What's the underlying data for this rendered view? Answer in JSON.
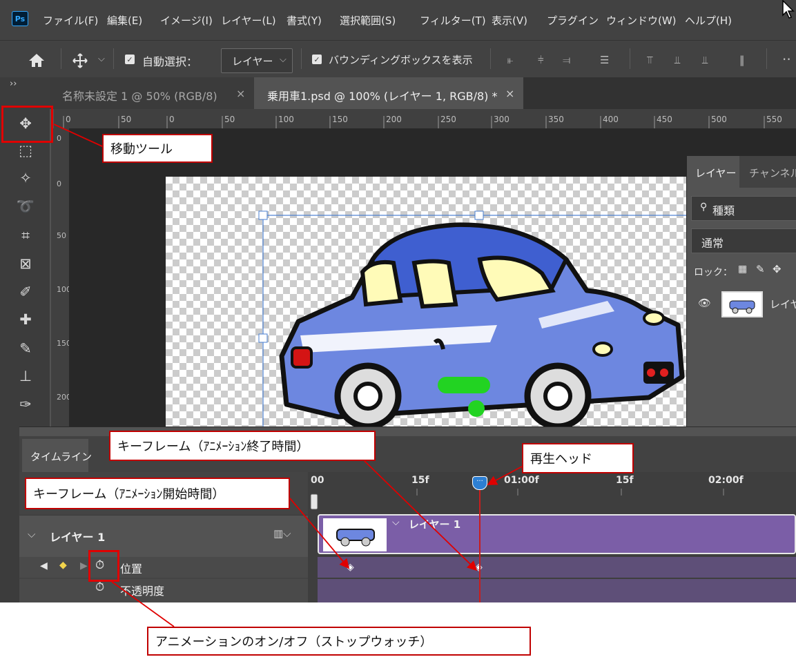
{
  "app": {
    "logo": "Ps"
  },
  "menu": [
    "ファイル(F)",
    "編集(E)",
    "イメージ(I)",
    "レイヤー(L)",
    "書式(Y)",
    "選択範囲(S)",
    "フィルター(T)",
    "表示(V)",
    "プラグイン",
    "ウィンドウ(W)",
    "ヘルプ(H)"
  ],
  "options": {
    "auto_select_label": "自動選択：",
    "auto_select_value": "レイヤー",
    "bounding_box_label": "バウンディングボックスを表示"
  },
  "tabs": [
    {
      "label": "名称未設定 1 @ 50% (RGB/8)",
      "close": "×"
    },
    {
      "label": "乗用車1.psd @ 100% (レイヤー 1, RGB/8) *",
      "close": "×"
    }
  ],
  "toolbar": {
    "collapse": "››"
  },
  "ruler": {
    "top": [
      "0",
      "50",
      "0",
      "50",
      "100",
      "150",
      "200",
      "250",
      "300",
      "350",
      "400",
      "450",
      "500",
      "550"
    ],
    "left": [
      "0",
      "0",
      "50",
      "100",
      "150",
      "200"
    ]
  },
  "layers_panel": {
    "tab_layers": "レイヤー",
    "tab_channels": "チャンネル",
    "filter_label": "種類",
    "blend_mode": "通常",
    "lock_label": "ロック：",
    "layer_name": "レイヤ"
  },
  "timeline": {
    "tab": "タイムライン",
    "time_labels": [
      "00",
      "15f",
      "01:00f",
      "15f",
      "02:00f"
    ],
    "layer_name": "レイヤー 1",
    "clip_name": "レイヤー 1",
    "prop_position": "位置",
    "prop_opacity": "不透明度"
  },
  "annotations": {
    "move_tool": "移動ツール",
    "keyframe_end": "キーフレーム（ｱﾆﾒｰｼｮﾝ終了時間）",
    "playhead": "再生ヘッド",
    "keyframe_start": "キーフレーム（ｱﾆﾒｰｼｮﾝ開始時間）",
    "stopwatch": "アニメーションのオン/オフ（ストップウォッチ）"
  },
  "colors": {
    "accent_red": "#e00000",
    "clip_purple": "#7b5ea7",
    "playhead_blue": "#2d7fd3"
  }
}
